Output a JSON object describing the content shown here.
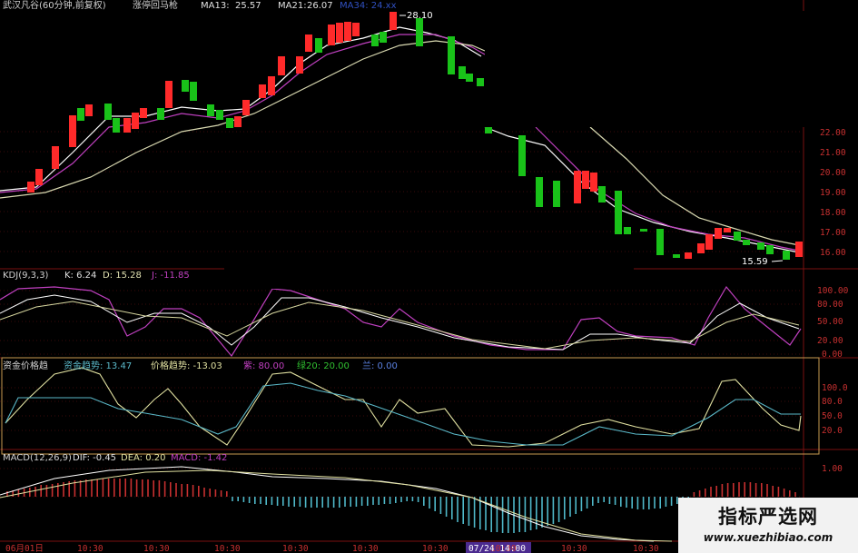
{
  "header": {
    "title": "武汉凡谷(60分钟,前复权)",
    "annotation": "涨停回马枪",
    "ma13_label": "MA13:",
    "ma13_value": "25.57",
    "ma21_label": "MA21:",
    "ma21_value": "26.07",
    "ma3_faded": "MA34: 24.xx"
  },
  "main_chart": {
    "high_label": "28.10",
    "low_label": "15.59",
    "price_ticks": [
      "22.00",
      "21.00",
      "20.00",
      "19.00",
      "18.00",
      "17.00",
      "16.00"
    ],
    "colors": {
      "up": "#ff2a2a",
      "down": "#19c219",
      "ma_fast": "#ffffff",
      "ma_mid": "#c040c0",
      "ma_slow": "#d8d8b0"
    }
  },
  "kdj": {
    "label": "KDJ(9,3,3)",
    "k": "K: 6.24",
    "d": "D: 15.28",
    "j": "J: -11.85",
    "ticks": [
      "100.00",
      "80.00",
      "50.00",
      "20.00",
      "0.00"
    ]
  },
  "fund": {
    "label": "资金价格趋",
    "fund_trend": "资金趋势: 13.47",
    "price_trend": "价格趋势: -13.03",
    "purple": "紫: 80.00",
    "green": "绿20: 20.00",
    "blue": "兰: 0.00",
    "ticks": [
      "100.0",
      "80.0",
      "50.0",
      "20.0"
    ]
  },
  "macd": {
    "label": "MACD(12,26,9)",
    "dif": "DIF: -0.45",
    "dea": "DEA: 0.20",
    "macd": "MACD: -1.42",
    "tick": "1.00"
  },
  "time_axis": {
    "labels": [
      "06月01日",
      "10:30",
      "10:30",
      "10:30",
      "10:30",
      "10:30",
      "10:30",
      "10:30",
      "07/24 14:00",
      "10:30",
      "10:30"
    ],
    "highlight": "07/24 14:00"
  },
  "watermark": {
    "cn": "指标严选网",
    "url": "www.xuezhibiao.com"
  }
}
